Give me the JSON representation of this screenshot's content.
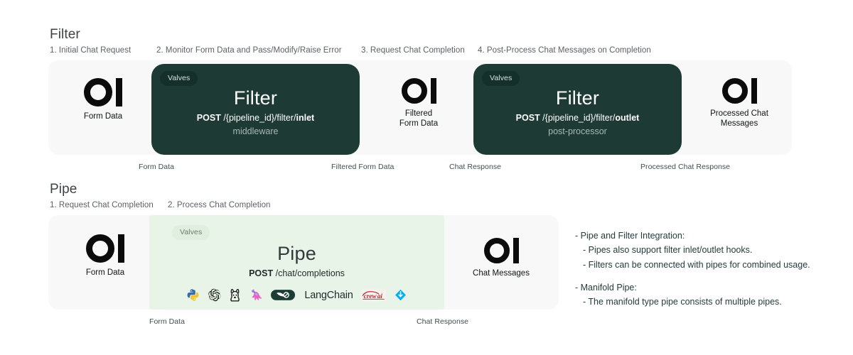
{
  "sections": [
    {
      "id": "filter",
      "title": "Filter",
      "steps": [
        "1. Initial Chat Request",
        "2. Monitor Form Data and Pass/Modify/Raise Error",
        "3. Request Chat Completion",
        "4. Post-Process Chat Messages on Completion"
      ],
      "flow_captions": [
        "Form Data",
        "Filtered Form Data",
        "Chat Response",
        "Processed Chat Response"
      ]
    },
    {
      "id": "pipe",
      "title": "Pipe",
      "steps": [
        "1. Request Chat Completion",
        "2. Process Chat Completion"
      ],
      "flow_captions": [
        "Form Data",
        "Chat Response"
      ]
    }
  ],
  "nodes": {
    "form_data": "Form Data",
    "filtered_form_data": "Filtered\nForm Data",
    "filtered_form_data_l1": "Filtered",
    "filtered_form_data_l2": "Form Data",
    "processed_chat_messages_l1": "Processed Chat",
    "processed_chat_messages_l2": "Messages",
    "chat_messages": "Chat Messages"
  },
  "cards": {
    "filter_inlet": {
      "valves": "Valves",
      "title": "Filter",
      "method": "POST",
      "path_prefix": "/{pipeline_id}/filter/",
      "path_suffix": "inlet",
      "subtitle": "middleware"
    },
    "filter_outlet": {
      "valves": "Valves",
      "title": "Filter",
      "method": "POST",
      "path_prefix": "/{pipeline_id}/filter/",
      "path_suffix": "outlet",
      "subtitle": "post-processor"
    },
    "pipe": {
      "valves": "Valves",
      "title": "Pipe",
      "method": "POST",
      "path_prefix": "/chat/completions",
      "path_suffix": "",
      "subtitle": ""
    }
  },
  "integrations": [
    {
      "name": "python-logo",
      "label": "Python"
    },
    {
      "name": "openai-logo",
      "label": "OpenAI"
    },
    {
      "name": "ollama-logo",
      "label": "Ollama"
    },
    {
      "name": "llamaindex-logo",
      "label": "LlamaIndex"
    },
    {
      "name": "langchain-logo",
      "label": "LangChain"
    },
    {
      "name": "crewai-logo",
      "label": "CrewAI"
    },
    {
      "name": "haystack-logo",
      "label": "Haystack"
    }
  ],
  "notes": {
    "line1": "- Pipe and Filter Integration:",
    "line2": "- Pipes also support filter inlet/outlet hooks.",
    "line3": "- Filters can be connected with pipes for combined usage.",
    "line4": "- Manifold Pipe:",
    "line5": "- The manifold type pipe consists of multiple pipes."
  },
  "colors": {
    "dark_card": "#1e3a35",
    "green_card": "#e9f4e9",
    "track": "#f7f8f7",
    "text_dark": "#253b3c",
    "logo_black": "#0b0b0b"
  }
}
